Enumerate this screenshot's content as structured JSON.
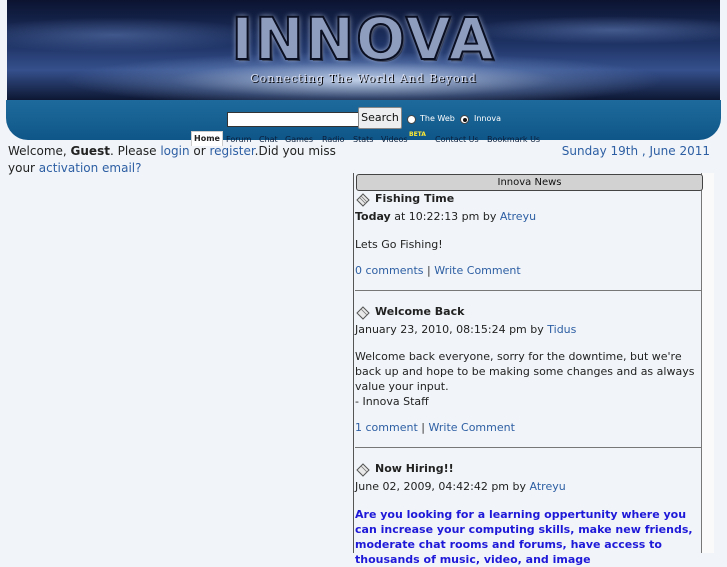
{
  "banner": {
    "logo_text": "INNOVA",
    "tagline": "Connecting The World And Beyond"
  },
  "search": {
    "input_value": "",
    "button_label": "Search",
    "options": [
      {
        "label": "The Web",
        "checked": false
      },
      {
        "label": "Innova",
        "checked": true
      }
    ]
  },
  "nav": {
    "items": [
      "Home",
      "Forum",
      "Chat",
      "Games",
      "Radio",
      "Stats",
      "Videos",
      "Contact Us",
      "Bookmark Us"
    ],
    "beta_badge": "BETA"
  },
  "welcome": {
    "prefix": "Welcome, ",
    "user": "Guest",
    "please": ". Please ",
    "login": "login",
    "or": " or ",
    "register": "register",
    "question": ".Did you miss your ",
    "activation": "activation email?"
  },
  "date": "Sunday 19th , June 2011",
  "news": {
    "header": "Innova News",
    "items": [
      {
        "title": "Fishing Time",
        "date_bold": "Today",
        "date_rest": " at 10:22:13 pm by ",
        "author": "Atreyu",
        "body": "Lets Go Fishing!",
        "comments": "0 comments",
        "separator": "|",
        "write": "Write Comment"
      },
      {
        "title": "Welcome Back",
        "date_rest": "January 23, 2010, 08:15:24 pm by ",
        "author": "Tidus",
        "body": "Welcome back everyone, sorry for the downtime, but we're back up and hope to be making some changes and as always value your input.",
        "signature": " - Innova Staff",
        "comments": "1 comment",
        "separator": "|",
        "write": "Write Comment"
      },
      {
        "title": "Now Hiring!!",
        "date_rest": "June 02, 2009, 04:42:42 pm by ",
        "author": "Atreyu",
        "body": "Are you looking for a learning oppertunity where you can increase your computing skills, make new friends, moderate chat rooms and forums, have access to thousands of music, video, and image"
      }
    ]
  },
  "colors": {
    "link": "#2d5ea3",
    "nav_bar": "#0f5688",
    "hiring_text": "#1e18d8",
    "beta": "#ffea33"
  }
}
